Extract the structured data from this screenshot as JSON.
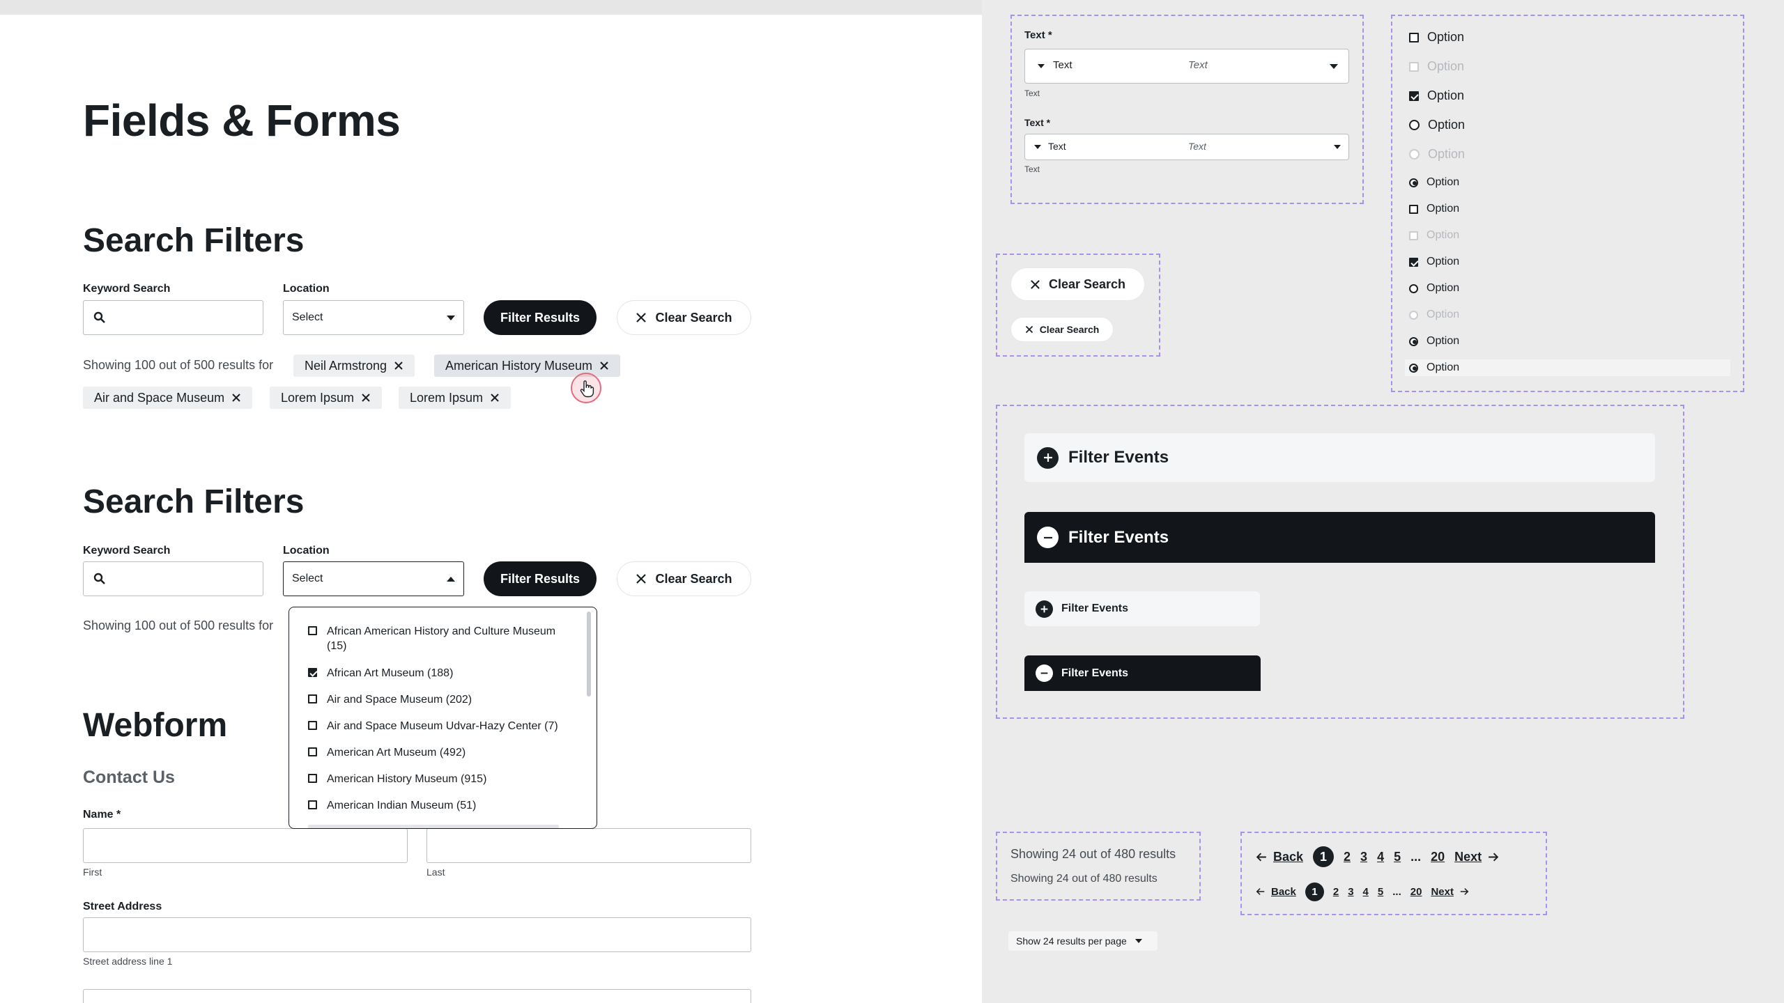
{
  "page_title": "Fields & Forms",
  "section1": {
    "title": "Search Filters",
    "keyword_label": "Keyword Search",
    "keyword_placeholder": "",
    "location_label": "Location",
    "location_value": "Select",
    "filter_button": "Filter Results",
    "clear_button": "Clear Search",
    "results_text": "Showing 100 out of 500 results for",
    "chips": [
      "Neil Armstrong",
      "American History Museum",
      "Air and Space Museum",
      "Lorem Ipsum",
      "Lorem Ipsum"
    ]
  },
  "section2": {
    "title": "Search Filters",
    "keyword_label": "Keyword Search",
    "location_label": "Location",
    "location_value": "Select",
    "filter_button": "Filter Results",
    "clear_button": "Clear Search",
    "results_text": "Showing 100 out of 500 results for",
    "dropdown_options": [
      {
        "label": "African American History and Culture Museum (15)",
        "checked": false
      },
      {
        "label": "African Art Museum (188)",
        "checked": true
      },
      {
        "label": "Air and Space Museum (202)",
        "checked": false
      },
      {
        "label": "Air and Space Museum Udvar-Hazy Center (7)",
        "checked": false
      },
      {
        "label": "American Art Museum (492)",
        "checked": false
      },
      {
        "label": "American History Museum (915)",
        "checked": false
      },
      {
        "label": "American Indian Museum (51)",
        "checked": false
      }
    ]
  },
  "webform": {
    "title": "Webform",
    "subtitle": "Contact Us",
    "name_label": "Name *",
    "first_help": "First",
    "last_help": "Last",
    "street_label": "Street Address",
    "street_help": "Street address line 1"
  },
  "text_fields": {
    "label1": "Text *",
    "select1_left": "Text",
    "select1_right": "Text",
    "help1": "Text",
    "label2": "Text *",
    "select2_left": "Text",
    "select2_right": "Text",
    "help2": "Text"
  },
  "clear_buttons": {
    "large": "Clear Search",
    "small": "Clear Search"
  },
  "options_large": [
    {
      "type": "checkbox",
      "state": "unchecked",
      "label": "Option"
    },
    {
      "type": "checkbox",
      "state": "disabled",
      "label": "Option"
    },
    {
      "type": "checkbox",
      "state": "checked",
      "label": "Option"
    },
    {
      "type": "radio",
      "state": "unchecked",
      "label": "Option"
    },
    {
      "type": "radio",
      "state": "disabled",
      "label": "Option"
    }
  ],
  "options_small": [
    {
      "type": "radio",
      "state": "selected",
      "label": "Option"
    },
    {
      "type": "checkbox",
      "state": "unchecked",
      "label": "Option"
    },
    {
      "type": "checkbox",
      "state": "disabled",
      "label": "Option"
    },
    {
      "type": "checkbox",
      "state": "checked",
      "label": "Option"
    },
    {
      "type": "radio",
      "state": "unchecked",
      "label": "Option"
    },
    {
      "type": "radio",
      "state": "disabled",
      "label": "Option"
    },
    {
      "type": "radio",
      "state": "selected",
      "label": "Option"
    },
    {
      "type": "radio",
      "state": "selected",
      "label": "Option"
    }
  ],
  "accordions": {
    "large_closed": "Filter Events",
    "large_open": "Filter Events",
    "small_closed": "Filter Events",
    "small_open": "Filter Events"
  },
  "results_count": {
    "large": "Showing 24 out of 480 results",
    "small": "Showing 24 out of 480 results"
  },
  "pagination": {
    "back": "Back",
    "next": "Next",
    "pages": [
      "1",
      "2",
      "3",
      "4",
      "5"
    ],
    "ellipsis": "...",
    "last": "20",
    "active": "1"
  },
  "per_page": "Show 24 results per page",
  "colors": {
    "dark": "#12161b",
    "accent_dash": "#a88ff0",
    "cursor_ring": "#e36a7d"
  }
}
